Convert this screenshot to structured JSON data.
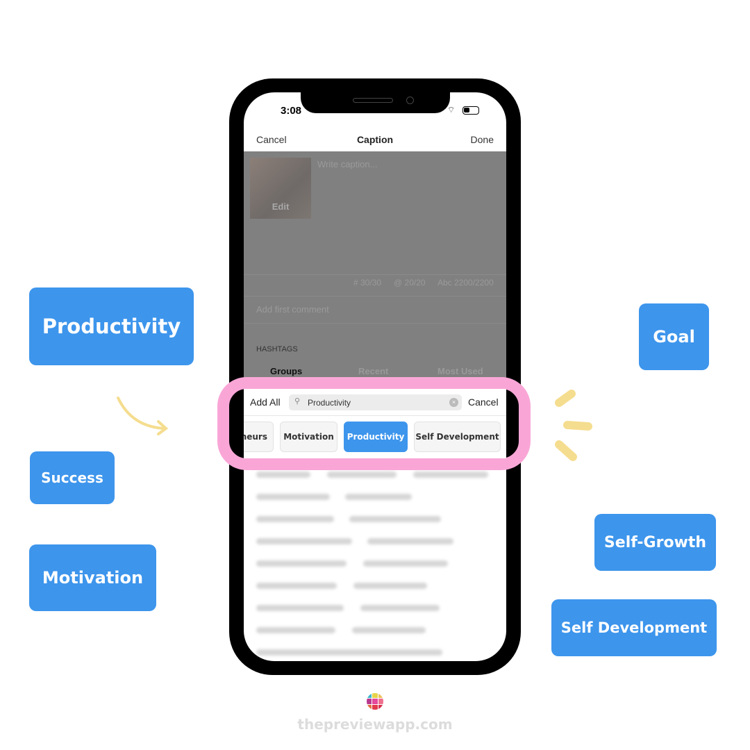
{
  "labels": [
    "Productivity",
    "Success",
    "Motivation",
    "Goal",
    "Self-Growth",
    "Self Development"
  ],
  "phone": {
    "status_time": "3:08",
    "nav": {
      "cancel": "Cancel",
      "title": "Caption",
      "done": "Done"
    },
    "thumbnail_edit": "Edit",
    "caption_placeholder": "Write caption...",
    "counters": {
      "hashtags": "# 30/30",
      "mentions": "@ 20/20",
      "chars": "Abc 2200/2200"
    },
    "first_comment_placeholder": "Add first comment",
    "hashtags_header": "HASHTAGS",
    "tabs": [
      "Groups",
      "Recent",
      "Most Used"
    ],
    "search": {
      "add_all": "Add All",
      "value": "Productivity",
      "cancel": "Cancel"
    },
    "chips": [
      {
        "label": "neurs",
        "selected": false
      },
      {
        "label": "Motivation",
        "selected": false
      },
      {
        "label": "Productivity",
        "selected": true
      },
      {
        "label": "Self Development",
        "selected": false
      }
    ]
  },
  "footer": {
    "site": "thepreviewapp.com"
  },
  "colors": {
    "tag_blue": "#3d95ec",
    "highlight_pink": "#f9a6d7",
    "accent_yellow": "#f5dd8f"
  }
}
